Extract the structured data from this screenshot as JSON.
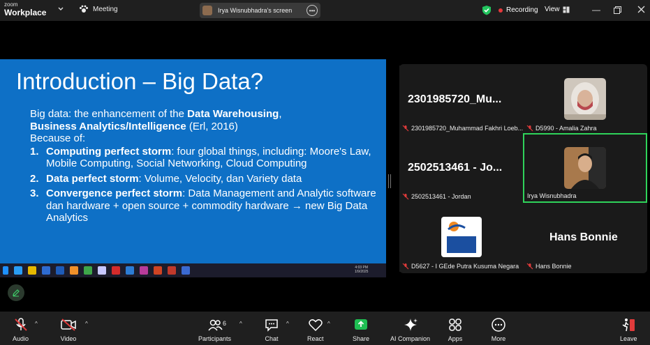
{
  "app": {
    "logo_small": "zoom",
    "logo_big": "Workplace"
  },
  "header": {
    "meeting_label": "Meeting",
    "screen_share_label": "Irya Wisnubhadra's screen",
    "recording_label": "Recording",
    "view_label": "View"
  },
  "slide": {
    "title": "Introduction – Big Data?",
    "intro_plain": "Big data: the enhancement of the ",
    "intro_bold1": "Data Warehousing",
    "intro_comma": ",",
    "intro_bold2": "Business Analytics/Intelligence",
    "intro_cite": " (Erl, 2016)",
    "because": "Because of:",
    "items": [
      {
        "num": "1.",
        "bold": "Computing perfect storm",
        "text": ": four global things, including: Moore's Law, Mobile Computing, Social Networking, Cloud Computing"
      },
      {
        "num": "2.",
        "bold": "Data perfect storm",
        "text": ": Volume, Velocity, dan Variety data"
      },
      {
        "num": "3.",
        "bold": "Convergence perfect storm",
        "text": ": Data Management and Analytic software dan hardware + open source + commodity hardware  → new Big Data Analytics"
      }
    ],
    "taskbar_time": "4:03 PM",
    "taskbar_date": "1/9/2025"
  },
  "gallery": {
    "tiles": [
      {
        "big_name": "2301985720_Mu...",
        "label": "2301985720_Muhammad Fakhri Loeb..."
      },
      {
        "big_name": "",
        "label": "D5990 - Amalia Zahra"
      },
      {
        "big_name": "2502513461 - Jo...",
        "label": "2502513461 - Jordan"
      },
      {
        "big_name": "",
        "label": "Irya Wisnubhadra"
      },
      {
        "big_name": "",
        "label": "D5627 - I GEde Putra Kusuma Negara",
        "logo_text": "BINUS UNIVERSITY GRADUATE PROGRAM"
      },
      {
        "big_name": "Hans Bonnie",
        "label": "Hans Bonnie"
      }
    ]
  },
  "toolbar": {
    "audio": "Audio",
    "video": "Video",
    "participants": "Participants",
    "participants_count": "6",
    "chat": "Chat",
    "react": "React",
    "share": "Share",
    "ai_companion": "AI Companion",
    "apps": "Apps",
    "more": "More",
    "leave": "Leave"
  },
  "colors": {
    "slide_bg": "#0e70c6",
    "share_green": "#1fbf53",
    "active_border": "#2fd35a",
    "recording_red": "#e5383b"
  }
}
